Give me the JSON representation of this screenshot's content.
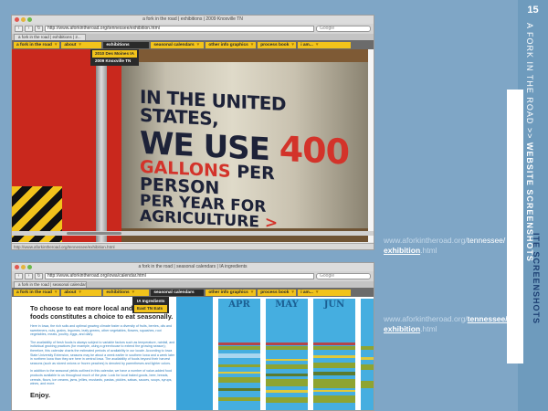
{
  "page_number": "15",
  "side_title": {
    "prefix": "A FORK IN THE ROAD >> ",
    "bold": "WEBSITE SCREENSHOTS",
    "ghost": "ITE SCREENSHOTS"
  },
  "colors": {
    "background": "#7fa6c6",
    "nav_yellow": "#f2c31b",
    "nav_dark": "#2a2a2a",
    "barrel_red": "#d3332a",
    "calendar_blue": "#45aee0"
  },
  "caption1": {
    "base": "www.aforkintheroad.org/",
    "part": "tennessee/",
    "page": "exhibition",
    "ext": ".html"
  },
  "caption2": {
    "base": "www.aforkintheroad.org/",
    "part": "tennessee/",
    "page": "exhibition",
    "ext": ".html"
  },
  "browser1": {
    "window_title": "a fork in the road | exhibitions | 2009 Knoxville TN",
    "url": "http://www.aforkintheroad.org/tennessee/exhibition.html",
    "search_placeholder": "Google",
    "tab": "a fork in the road | exhibitions | 2...",
    "status": "http://www.aforkintheroad.org/tennessee/exhibition.html",
    "nav": [
      "a fork in the road",
      "about",
      "exhibitions",
      "seasonal calendars",
      "other info graphics",
      "process book",
      "i am..."
    ],
    "dropdown": [
      "2010 Des Moines IA",
      "2009 Knoxville TN"
    ],
    "barrel": {
      "line1": "IN THE UNITED STATES,",
      "line2_a": "WE USE ",
      "line2_b": "400",
      "line3_a": "GALLONS",
      "line3_b": " PER PERSON",
      "line4": "PER YEAR FOR AGRICULTURE",
      "arrow": ">"
    }
  },
  "browser2": {
    "window_title": "a fork in the road | seasonal calendars | IA ingredients",
    "url": "http://www.aforkintheroad.org/iowa/calendar.html",
    "search_placeholder": "Google",
    "tab": "a fork in the road | seasonal calendar...",
    "nav": [
      "a fork in the road",
      "about",
      "exhibitions",
      "seasonal calendars",
      "other info graphics",
      "process book",
      "i am..."
    ],
    "dropdown": [
      "IA Ingredients",
      "East TN Eats"
    ],
    "heading": "To choose to eat more local and regional foods constitutes a choice to eat seasonally.",
    "para1": "Here in Iowa, the rich soils and optimal growing climate foster a diversity of fruits, berries, oils and sweeteners, nuts, grains, legumes, leafy greens, other vegetables, flowers, squashes, root vegetables, meats, poultry, eggs, and dairy.",
    "para2": "The availability of fresh foods is always subject to variable factors such as temperature, rainfall, and individual growing practices (for example, using a greenhouse to extend the growing season); therefore, this calendar charts the estimated periods of availability in our locale. According to Iowa State University Extension, seasons may be about a week earlier in southern Iowa and a week later in northern Iowa than they are here in central Iowa. The availability of foods beyond their harvest seasons (such as stored onions or frozen peaches) is denoted by parentheses and lighter colors.",
    "para3": "In addition to the seasonal yields outlined in this calendar, we have a number of value-added food products available to us throughout much of the year. Look for local baked goods, beer, breads, cereals, flours, ice creams, jams, jellies, mustards, pastas, pickles, salsas, sauces, soups, syrups, wines, and more.",
    "enjoy": "Enjoy.",
    "months": [
      "APR",
      "MAY",
      "JUN"
    ]
  }
}
